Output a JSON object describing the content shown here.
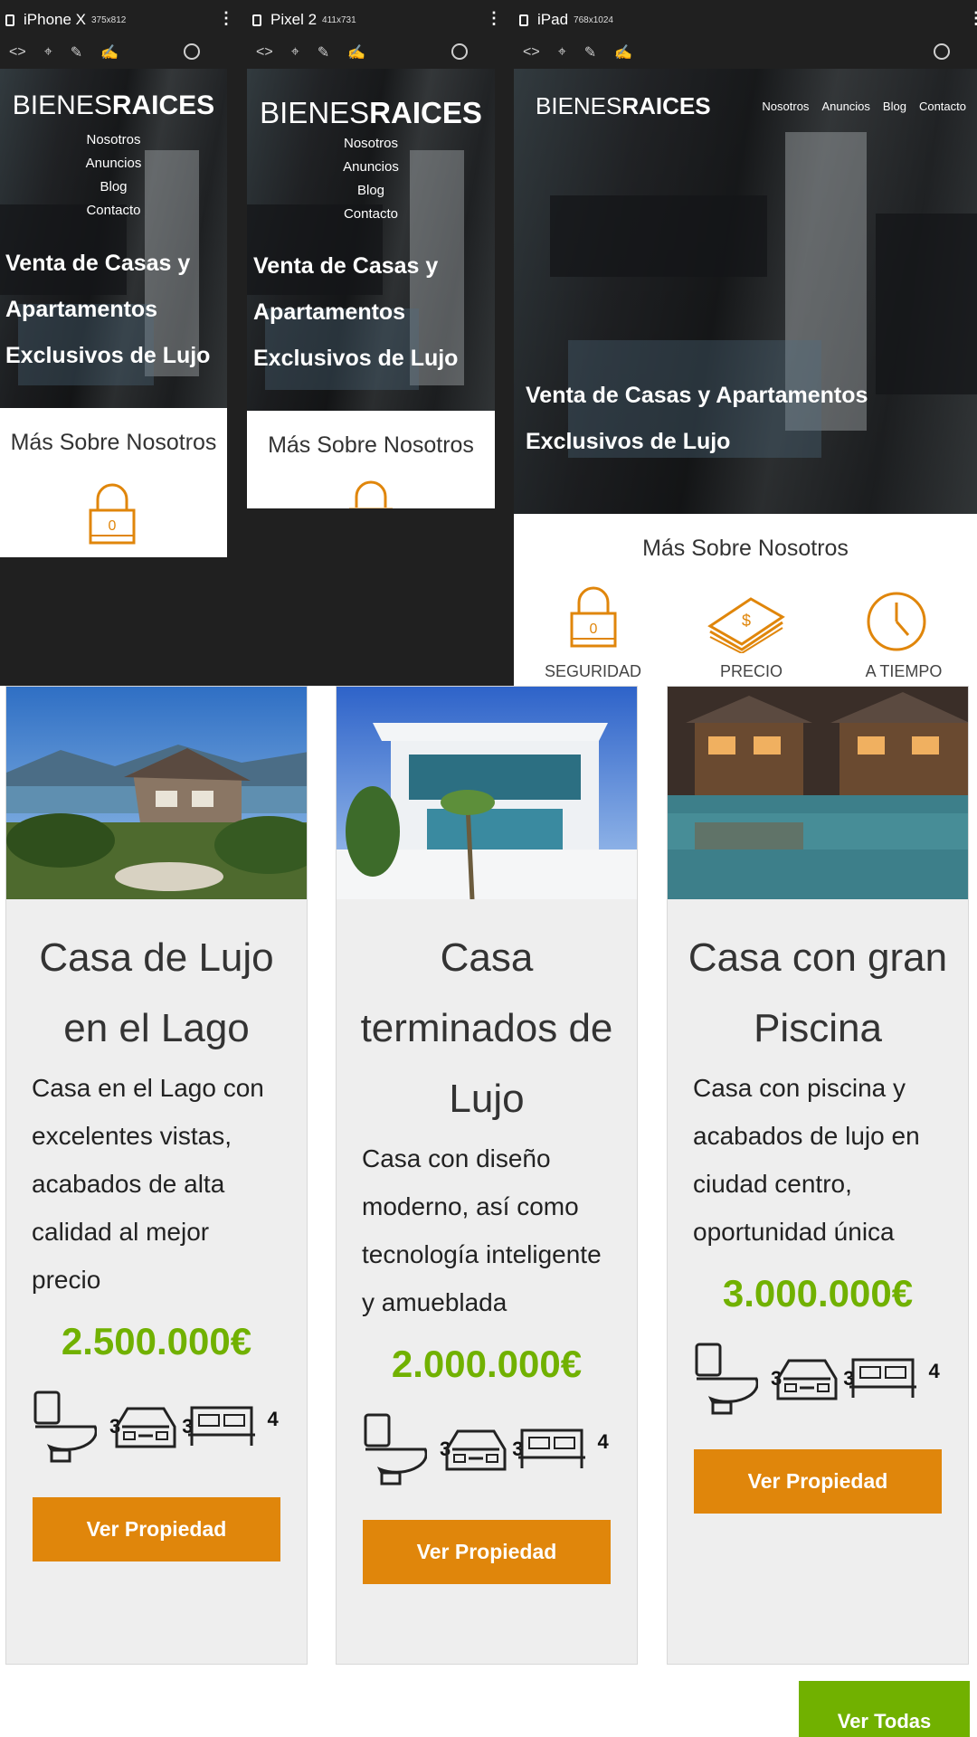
{
  "devices": [
    {
      "name": "iPhone X",
      "size": "375x812"
    },
    {
      "name": "Pixel 2",
      "size": "411x731"
    },
    {
      "name": "iPad",
      "size": "768x1024"
    }
  ],
  "site": {
    "logo_light": "BIENES",
    "logo_bold": "RAICES",
    "nav": [
      "Nosotros",
      "Anuncios",
      "Blog",
      "Contacto"
    ],
    "hero_lines_phone": [
      "Venta de Casas y",
      "Apartamentos",
      "Exclusivos de Lujo"
    ],
    "hero_lines_tablet": [
      "Venta de Casas y Apartamentos",
      "Exclusivos de Lujo"
    ],
    "about_title": "Más Sobre Nosotros",
    "lock_digit": "0",
    "features": [
      "SEGURIDAD",
      "PRECIO",
      "A TIEMPO"
    ]
  },
  "cards": [
    {
      "title": "Casa de Lujo en el Lago",
      "description": "Casa en el Lago con excelentes vistas, acabados de alta calidad al mejor precio",
      "price": "2.500.000€",
      "wc": "3",
      "parking": "3",
      "rooms": "4",
      "button": "Ver Propiedad"
    },
    {
      "title": "Casa terminados de Lujo",
      "description": "Casa con diseño moderno, así como tecnología inteligente y amueblada",
      "price": "2.000.000€",
      "wc": "3",
      "parking": "3",
      "rooms": "4",
      "button": "Ver Propiedad"
    },
    {
      "title": "Casa con gran Piscina",
      "description": "Casa con piscina y acabados de lujo en ciudad centro, oportunidad única",
      "price": "3.000.000€",
      "wc": "3",
      "parking": "3",
      "rooms": "4",
      "button": "Ver Propiedad"
    }
  ],
  "view_all": "Ver Todas",
  "colors": {
    "accent_orange": "#e0860b",
    "price_green": "#71b100",
    "chrome_bg": "#202020"
  }
}
